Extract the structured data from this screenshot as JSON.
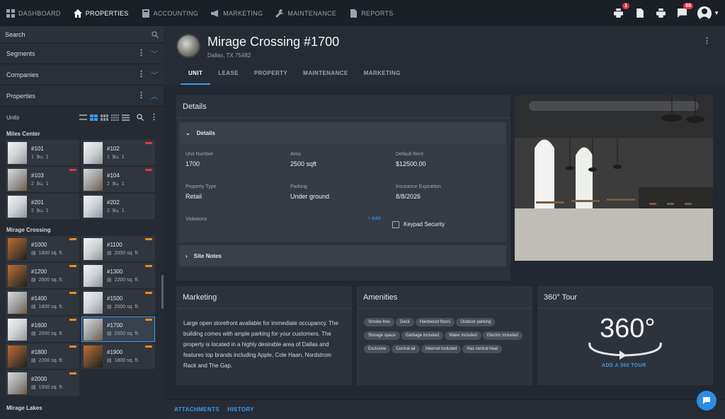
{
  "nav": {
    "items": [
      {
        "label": "DASHBOARD",
        "icon": "dashboard-icon",
        "active": false
      },
      {
        "label": "PROPERTIES",
        "icon": "home-icon",
        "active": true
      },
      {
        "label": "ACCOUNTING",
        "icon": "accounting-icon",
        "active": false
      },
      {
        "label": "MARKETING",
        "icon": "megaphone-icon",
        "active": false
      },
      {
        "label": "MAINTENANCE",
        "icon": "wrench-icon",
        "active": false
      },
      {
        "label": "REPORTS",
        "icon": "report-icon",
        "active": false
      }
    ],
    "badges": {
      "printer_queue": "1",
      "messages": "69"
    }
  },
  "sidebar": {
    "search_placeholder": "Search",
    "sections": [
      {
        "label": "Segments",
        "expanded": false
      },
      {
        "label": "Companies",
        "expanded": false
      },
      {
        "label": "Properties",
        "expanded": true
      }
    ],
    "units_label": "Units",
    "groups": [
      {
        "title": "Miles Center",
        "units": [
          {
            "name": "#101",
            "meta": "1",
            "meta2": "1",
            "flag": "#e0344a"
          },
          {
            "name": "#102",
            "meta": "1",
            "meta2": "1",
            "flag": "#e0344a"
          },
          {
            "name": "#103",
            "meta": "2",
            "meta2": "1",
            "flag": "#e0344a"
          },
          {
            "name": "#104",
            "meta": "2",
            "meta2": "1",
            "flag": "#e0344a"
          },
          {
            "name": "#201",
            "meta": "2",
            "meta2": "1",
            "flag": ""
          },
          {
            "name": "#202",
            "meta": "2",
            "meta2": "1",
            "flag": ""
          }
        ]
      },
      {
        "title": "Mirage Crossing",
        "units": [
          {
            "name": "#1000",
            "meta": "1800 sq. ft.",
            "flag": "#f08a24"
          },
          {
            "name": "#1100",
            "meta": "2000 sq. ft.",
            "flag": "#f08a24"
          },
          {
            "name": "#1200",
            "meta": "2500 sq. ft.",
            "flag": "#f08a24"
          },
          {
            "name": "#1300",
            "meta": "2200 sq. ft.",
            "flag": "#f08a24"
          },
          {
            "name": "#1400",
            "meta": "1800 sq. ft.",
            "flag": "#f08a24"
          },
          {
            "name": "#1500",
            "meta": "2000 sq. ft.",
            "flag": "#f08a24"
          },
          {
            "name": "#1600",
            "meta": "2000 sq. ft.",
            "flag": "#f08a24"
          },
          {
            "name": "#1700",
            "meta": "2500 sq. ft.",
            "flag": "#f08a24",
            "selected": true
          },
          {
            "name": "#1800",
            "meta": "2200 sq. ft.",
            "flag": "#f08a24"
          },
          {
            "name": "#1900",
            "meta": "1800 sq. ft.",
            "flag": "#f08a24"
          },
          {
            "name": "#2000",
            "meta": "1500 sq. ft.",
            "flag": "#f08a24"
          }
        ]
      }
    ],
    "next_group": "Mirage Lakes"
  },
  "header": {
    "title": "Mirage Crossing #1700",
    "subtitle": "Dallas, TX 75482",
    "tabs": [
      "UNIT",
      "LEASE",
      "PROPERTY",
      "MAINTENANCE",
      "MARKETING"
    ]
  },
  "details": {
    "panel_title": "Details",
    "section_title": "Details",
    "fields": [
      {
        "label": "Unit Number",
        "value": "1700"
      },
      {
        "label": "Area",
        "value": "2500 sqft"
      },
      {
        "label": "Default Rent",
        "value": "$12500.00"
      },
      {
        "label": "Property Type",
        "value": "Retail"
      },
      {
        "label": "Parking",
        "value": "Under ground"
      },
      {
        "label": "Insurance Expiration",
        "value": "8/8/2026"
      }
    ],
    "violations_label": "Violations",
    "add_label": "+ Add",
    "keypad_label": "Keypad Security",
    "site_notes_label": "Site Notes"
  },
  "marketing": {
    "title": "Marketing",
    "text": "Large open storefront available for immediate occupancy. The building comes with ample parking for your customers. The property is located in a highly desirable area of Dallas and features top brands including Apple, Cole Haan, Nordstrom Rack and The Gap."
  },
  "amenities": {
    "title": "Amenities",
    "items": [
      "Smoke-free",
      "Deck",
      "Hardwood floors",
      "Outdoor parking",
      "Storage space",
      "Garbage included",
      "Water included",
      "Electric included",
      "Exclusive",
      "Central air",
      "Internet included",
      "Has central heat"
    ]
  },
  "tour": {
    "title": "360° Tour",
    "graphic_text": "360°",
    "link": "ADD A 360 TOUR"
  },
  "footer": {
    "links": [
      "ATTACHMENTS",
      "HISTORY"
    ]
  },
  "colors": {
    "accent": "#3a9bf0",
    "alert": "#e0344a",
    "warning": "#f08a24"
  }
}
